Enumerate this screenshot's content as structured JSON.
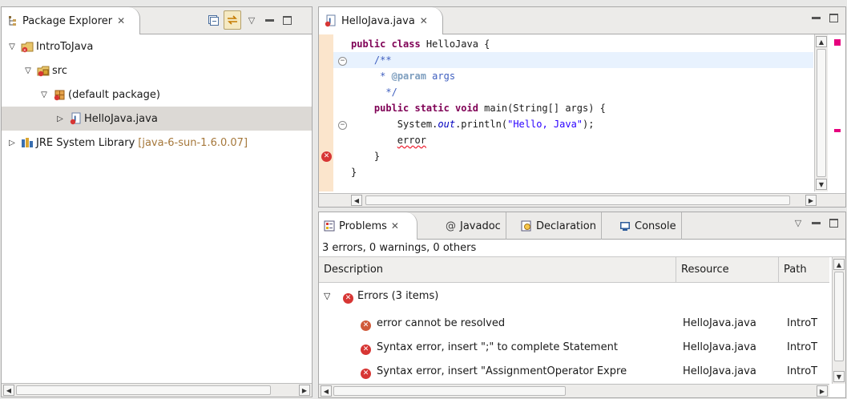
{
  "package_explorer": {
    "tab_title": "Package Explorer",
    "tree": [
      {
        "label": "IntroToJava",
        "level": 0,
        "expanded": true
      },
      {
        "label": "src",
        "level": 1,
        "expanded": true
      },
      {
        "label": "(default package)",
        "level": 2,
        "expanded": true
      },
      {
        "label": "HelloJava.java",
        "level": 3,
        "expanded": false,
        "selected": true
      },
      {
        "label": "JRE System Library",
        "suffix": "[java-6-sun-1.6.0.07]",
        "level": 0,
        "expanded": false
      }
    ]
  },
  "editor": {
    "tab_title": "HelloJava.java",
    "lines": [
      {
        "kw": "public class",
        "rest": " HelloJava {"
      },
      {
        "text": "/**"
      },
      {
        "star": " * ",
        "tag": "@param",
        "rest": " args"
      },
      {
        "text": " */"
      },
      {
        "kw": "public static void",
        "rest": " main(String[] args) {"
      },
      {
        "pre": "System.",
        "field": "out",
        "mid": ".println(",
        "str": "\"Hello, Java\"",
        "post": ");"
      },
      {
        "text": "error"
      },
      {
        "text": "}"
      },
      {
        "text": "}"
      }
    ]
  },
  "problems": {
    "tabs": [
      "Problems",
      "Javadoc",
      "Declaration",
      "Console"
    ],
    "summary": "3 errors, 0 warnings, 0 others",
    "columns": [
      "Description",
      "Resource",
      "Path"
    ],
    "group_label": "Errors (3 items)",
    "rows": [
      {
        "description": "error cannot be resolved",
        "resource": "HelloJava.java",
        "path": "IntroT"
      },
      {
        "description": "Syntax error, insert \";\" to complete Statement",
        "resource": "HelloJava.java",
        "path": "IntroT"
      },
      {
        "description": "Syntax error, insert \"AssignmentOperator Expre",
        "resource": "HelloJava.java",
        "path": "IntroT"
      }
    ]
  },
  "colors": {
    "error": "#d73634",
    "keyword": "#7f0055",
    "comment": "#3f5fbf",
    "string": "#2a00ff",
    "library_version": "#a5773a"
  },
  "icons": [
    "hierarchy-icon",
    "collapse-all-icon",
    "link-editor-icon",
    "view-menu-icon",
    "minimize-icon",
    "maximize-icon",
    "java-project-icon",
    "source-folder-icon",
    "package-icon",
    "java-file-icon",
    "library-icon",
    "problems-icon",
    "javadoc-icon",
    "declaration-icon",
    "console-icon",
    "error-icon"
  ]
}
